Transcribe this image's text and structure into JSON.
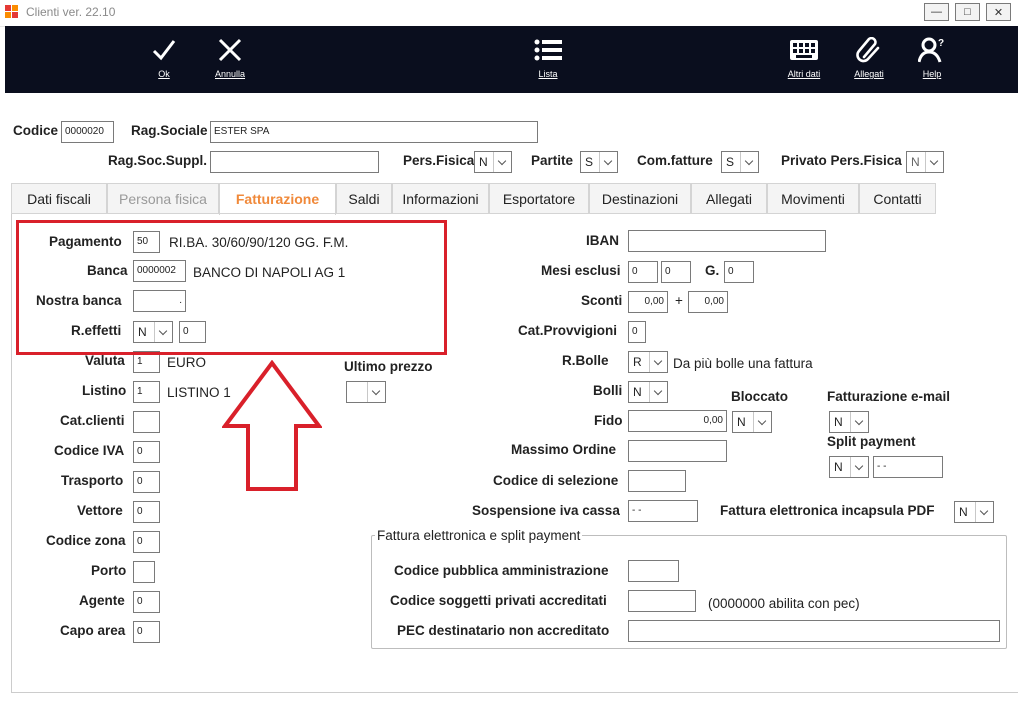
{
  "window": {
    "title": "Clienti ver. 22.10",
    "controls": {
      "minimize": "—",
      "restore": "□",
      "close": "✕"
    }
  },
  "toolbar": {
    "ok": "Ok",
    "annulla": "Annulla",
    "lista": "Lista",
    "altri_dati": "Altri dati",
    "allegati": "Allegati",
    "help": "Help"
  },
  "header": {
    "codice_label": "Codice",
    "codice_value": "0000020",
    "rag_sociale_label": "Rag.Sociale",
    "rag_sociale_value": "ESTER SPA",
    "rag_soc_suppl_label": "Rag.Soc.Suppl.",
    "rag_soc_suppl_value": "",
    "pers_fisica_label": "Pers.Fisica",
    "pers_fisica_value": "N",
    "partite_label": "Partite",
    "partite_value": "S",
    "com_fatture_label": "Com.fatture",
    "com_fatture_value": "S",
    "privato_label": "Privato Pers.Fisica",
    "privato_value": "N"
  },
  "tabs": [
    {
      "label": "Dati fiscali"
    },
    {
      "label": "Persona fisica"
    },
    {
      "label": "Fatturazione"
    },
    {
      "label": "Saldi"
    },
    {
      "label": "Informazioni"
    },
    {
      "label": "Esportatore"
    },
    {
      "label": "Destinazioni"
    },
    {
      "label": "Allegati"
    },
    {
      "label": "Movimenti"
    },
    {
      "label": "Contatti"
    }
  ],
  "left": {
    "pagamento_label": "Pagamento",
    "pagamento_code": "50",
    "pagamento_desc": "RI.BA. 30/60/90/120 GG. F.M.",
    "banca_label": "Banca",
    "banca_code": "0000002",
    "banca_desc": "BANCO DI NAPOLI AG 1",
    "nostra_banca_label": "Nostra banca",
    "nostra_banca_value": ".",
    "r_effetti_label": "R.effetti",
    "r_effetti_value": "N",
    "r_effetti_num": "0",
    "valuta_label": "Valuta",
    "valuta_code": "1",
    "valuta_desc": "EURO",
    "listino_label": "Listino",
    "listino_code": "1",
    "listino_desc": "LISTINO 1",
    "ultimo_prezzo_label": "Ultimo prezzo",
    "ultimo_prezzo_value": "",
    "cat_clienti_label": "Cat.clienti",
    "cat_clienti_value": "",
    "codice_iva_label": "Codice IVA",
    "codice_iva_value": "0",
    "trasporto_label": "Trasporto",
    "trasporto_value": "0",
    "vettore_label": "Vettore",
    "vettore_value": "0",
    "codice_zona_label": "Codice zona",
    "codice_zona_value": "0",
    "porto_label": "Porto",
    "porto_value": "",
    "agente_label": "Agente",
    "agente_value": "0",
    "capo_area_label": "Capo area",
    "capo_area_value": "0"
  },
  "right": {
    "iban_label": "IBAN",
    "iban_value": "",
    "mesi_esclusi_label": "Mesi esclusi",
    "mesi_1": "0",
    "mesi_2": "0",
    "g_label": "G.",
    "g_value": "0",
    "sconti_label": "Sconti",
    "sconto_1": "0,00",
    "plus": "+",
    "sconto_2": "0,00",
    "cat_provvigioni_label": "Cat.Provvigioni",
    "cat_provvigioni_value": "0",
    "r_bolle_label": "R.Bolle",
    "r_bolle_value": "R",
    "r_bolle_desc": "Da più bolle una fattura",
    "bolli_label": "Bolli",
    "bolli_value": "N",
    "bloccato_label": "Bloccato",
    "bloccato_value": "N",
    "fatt_email_label": "Fatturazione e-mail",
    "fatt_email_value": "N",
    "fido_label": "Fido",
    "fido_value": "0,00",
    "split_label": "Split payment",
    "split_value": "N",
    "split_date": "- -",
    "massimo_ordine_label": "Massimo Ordine",
    "massimo_ordine_value": "",
    "codice_selezione_label": "Codice di selezione",
    "codice_selezione_value": "",
    "sospensione_label": "Sospensione iva cassa",
    "sospensione_value": "- -",
    "fatt_pdf_label": "Fattura elettronica incapsula PDF",
    "fatt_pdf_value": "N"
  },
  "group": {
    "title": "Fattura elettronica e split payment",
    "codice_pa_label": "Codice pubblica amministrazione",
    "codice_pa_value": "",
    "codice_sogg_label": "Codice soggetti privati accreditati",
    "codice_sogg_value": "",
    "codice_sogg_note": "(0000000 abilita con pec)",
    "pec_label": "PEC destinatario non accreditato",
    "pec_value": ""
  },
  "colors": {
    "toolbar_bg": "#0a0e1e",
    "active_tab": "#f0893a",
    "annotation_red": "#d9202a"
  }
}
